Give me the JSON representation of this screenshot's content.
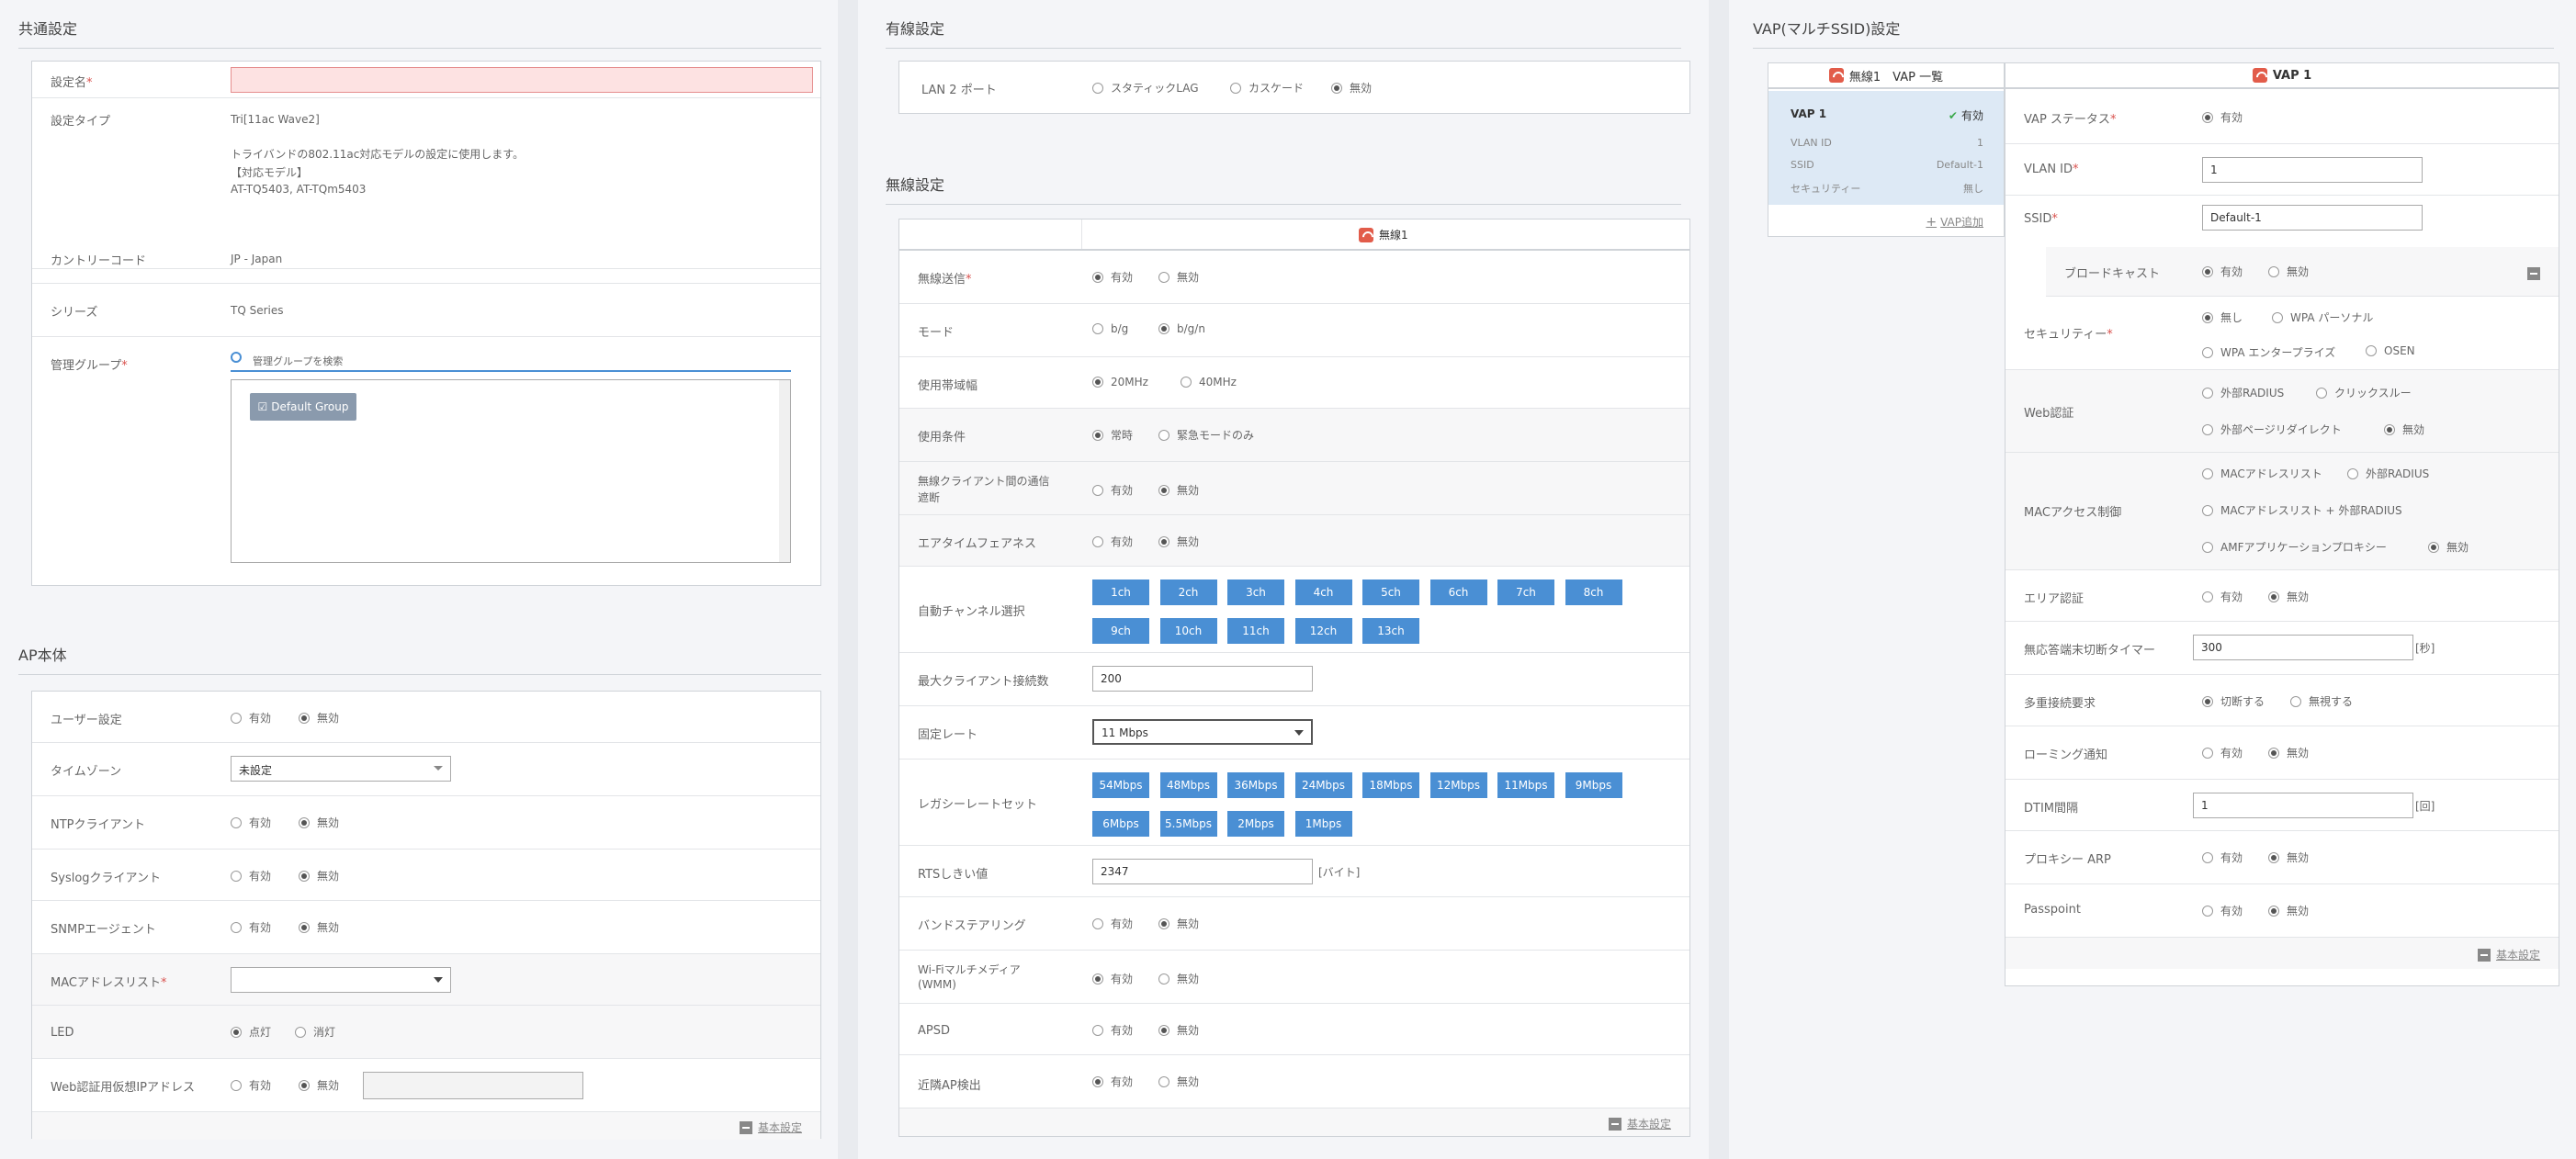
{
  "common": {
    "heading": "共通設定",
    "name_label": "設定名",
    "type_label": "設定タイプ",
    "type_value": "Tri[11ac Wave2]",
    "type_desc": "トライバンドの802.11ac対応モデルの設定に使用します。",
    "type_models_title": "【対応モデル】",
    "type_models": "AT-TQ5403, AT-TQm5403",
    "country_label": "カントリーコード",
    "country_value": "JP - Japan",
    "series_label": "シリーズ",
    "series_value": "TQ Series",
    "group_label": "管理グループ",
    "group_search_placeholder": "管理グループを検索",
    "group_item": "Default Group"
  },
  "ap": {
    "heading": "AP本体",
    "user_label": "ユーザー設定",
    "tz_label": "タイムゾーン",
    "tz_value": "未設定",
    "ntp_label": "NTPクライアント",
    "syslog_label": "Syslogクライアント",
    "snmp_label": "SNMPエージェント",
    "mac_label": "MACアドレスリスト",
    "led_label": "LED",
    "led_on": "点灯",
    "led_off": "消灯",
    "webauth_label": "Web認証用仮想IPアドレス",
    "basic_link": "基本設定"
  },
  "opts": {
    "enable": "有効",
    "disable": "無効"
  },
  "wired": {
    "heading": "有線設定",
    "lan2_label": "LAN 2 ポート",
    "static_lag": "スタティックLAG",
    "cascade": "カスケード",
    "disable": "無効"
  },
  "wireless": {
    "heading": "無線設定",
    "radio_title": "無線1",
    "tx_label": "無線送信",
    "mode_label": "モード",
    "mode_bg": "b/g",
    "mode_bgn": "b/g/n",
    "bw_label": "使用帯域幅",
    "bw_20": "20MHz",
    "bw_40": "40MHz",
    "cond_label": "使用条件",
    "cond_always": "常時",
    "cond_emerg": "緊急モードのみ",
    "iso_label1": "無線クライアント間の通信",
    "iso_label2": "遮断",
    "airtime_label": "エアタイムフェアネス",
    "autoch_label": "自動チャンネル選択",
    "channels": [
      "1ch",
      "2ch",
      "3ch",
      "4ch",
      "5ch",
      "6ch",
      "7ch",
      "8ch",
      "9ch",
      "10ch",
      "11ch",
      "12ch",
      "13ch"
    ],
    "maxcli_label": "最大クライアント接続数",
    "maxcli_value": "200",
    "fixrate_label": "固定レート",
    "fixrate_value": "11 Mbps",
    "legacy_label": "レガシーレートセット",
    "rates": [
      "54Mbps",
      "48Mbps",
      "36Mbps",
      "24Mbps",
      "18Mbps",
      "12Mbps",
      "11Mbps",
      "9Mbps",
      "6Mbps",
      "5.5Mbps",
      "2Mbps",
      "1Mbps"
    ],
    "rts_label": "RTSしきい値",
    "rts_value": "2347",
    "rts_unit": "[バイト]",
    "band_label": "バンドステアリング",
    "wmm_label1": "Wi-Fiマルチメディア",
    "wmm_label2": "(WMM)",
    "apsd_label": "APSD",
    "nbr_label": "近隣AP検出",
    "basic_link": "基本設定"
  },
  "vap": {
    "heading": "VAP(マルチSSID)設定",
    "list_title": "無線1　VAP 一覧",
    "item_name": "VAP 1",
    "item_status": "有効",
    "vlan_k": "VLAN ID",
    "vlan_v": "1",
    "ssid_k": "SSID",
    "ssid_v": "Default-1",
    "sec_k": "セキュリティー",
    "sec_v": "無し",
    "add_link": "VAP追加",
    "detail_title": "VAP 1",
    "status_label": "VAP ステータス",
    "vlan_label": "VLAN ID",
    "vlan_value": "1",
    "ssid_label": "SSID",
    "ssid_value": "Default-1",
    "bcast_label": "ブロードキャスト",
    "sec_label": "セキュリティー",
    "sec_none": "無し",
    "sec_wpa_p": "WPA パーソナル",
    "sec_wpa_e": "WPA エンタープライズ",
    "sec_osen": "OSEN",
    "web_label": "Web認証",
    "web_radius": "外部RADIUS",
    "web_click": "クリックスルー",
    "web_ext": "外部ページリダイレクト",
    "mac_label": "MACアクセス制御",
    "mac_list": "MACアドレスリスト",
    "mac_radius": "外部RADIUS",
    "mac_list_radius": "MACアドレスリスト + 外部RADIUS",
    "mac_amf": "AMFアプリケーションプロキシー",
    "area_label": "エリア認証",
    "timer_label": "無応答端末切断タイマー",
    "timer_value": "300",
    "timer_unit": "[秒]",
    "multi_label": "多重接続要求",
    "multi_cut": "切断する",
    "multi_ignore": "無視する",
    "roam_label": "ローミング通知",
    "dtim_label": "DTIM間隔",
    "dtim_value": "1",
    "dtim_unit": "[回]",
    "proxy_label": "プロキシー ARP",
    "pp_label": "Passpoint",
    "basic_link": "基本設定"
  }
}
